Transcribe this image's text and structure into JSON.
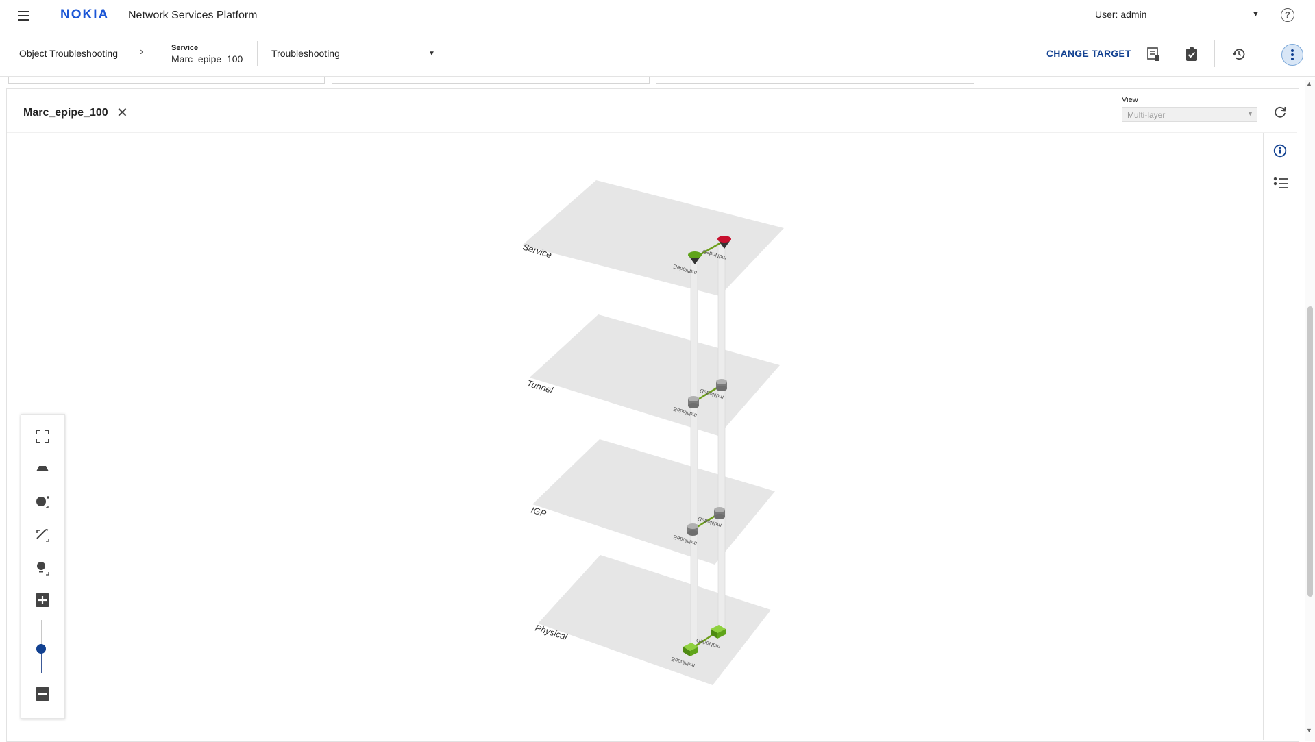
{
  "header": {
    "brand": "NOKIA",
    "app_title": "Network Services Platform",
    "user_label": "User: admin",
    "help_glyph": "?"
  },
  "subheader": {
    "breadcrumb_root": "Object Troubleshooting",
    "breadcrumb_separator": "›",
    "object_kind": "Service",
    "object_name": "Marc_epipe_100",
    "mode": "Troubleshooting",
    "change_target_label": "CHANGE TARGET"
  },
  "panel": {
    "title": "Marc_epipe_100",
    "close_glyph": "✕",
    "view_label": "View",
    "view_value": "Multi-layer"
  },
  "topology": {
    "layers": [
      {
        "name": "Service"
      },
      {
        "name": "Tunnel"
      },
      {
        "name": "IGP"
      },
      {
        "name": "Physical"
      }
    ],
    "nodes": [
      "mdNodeE",
      "mdNodeD"
    ],
    "colors": {
      "layer_fill": "#e6e6e6",
      "link_green": "#6e9f1c",
      "node_ok": "#5fa41a",
      "node_alarm": "#c8102e",
      "router_gray": "#8d8d8d",
      "pillar": "#e8e8e8"
    }
  },
  "icons": {
    "menu": "hamburger-icon",
    "help": "help-circle-icon",
    "report": "report-icon",
    "checklist": "clipboard-check-icon",
    "history": "history-icon",
    "more": "more-vertical-icon",
    "refresh": "refresh-icon",
    "info": "info-icon",
    "list": "list-icon",
    "fullscreen": "fullscreen-icon",
    "perspective": "perspective-icon",
    "node_size": "node-size-icon",
    "link_width": "link-width-icon",
    "label_toggle": "label-toggle-icon",
    "zoom_in": "zoom-in-icon",
    "zoom_out": "zoom-out-icon"
  },
  "zoom": {
    "level_fraction": 0.55
  }
}
